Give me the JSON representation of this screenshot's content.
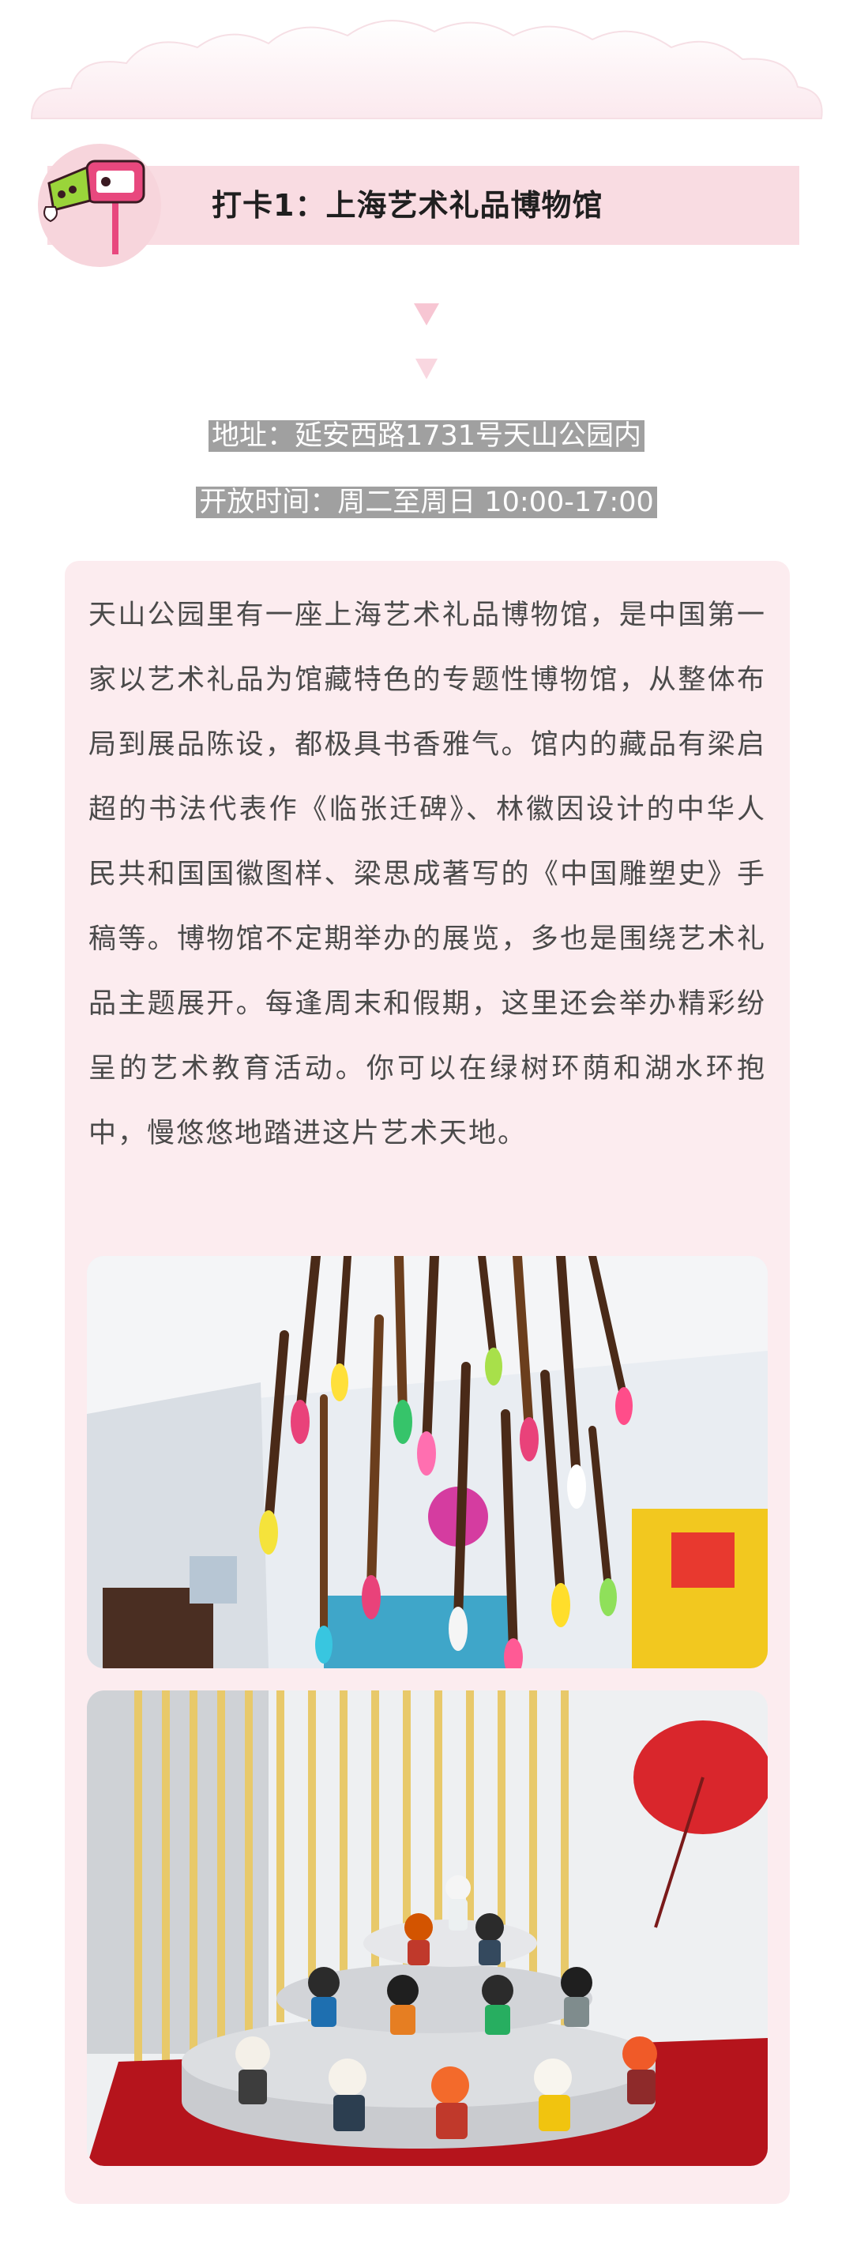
{
  "header": {
    "title": "打卡1：上海艺术礼品博物馆"
  },
  "info": {
    "address": "地址：延安西路1731号天山公园内",
    "hours": "开放时间：周二至周日 10:00-17:00"
  },
  "body": {
    "paragraph": "天山公园里有一座上海艺术礼品博物馆，是中国第一家以艺术礼品为馆藏特色的专题性博物馆，从整体布局到展品陈设，都极具书香雅气。馆内的藏品有梁启超的书法代表作《临张迁碑》、林徽因设计的中华人民共和国国徽图样、梁思成著写的《中国雕塑史》手稿等。博物馆不定期举办的展览，多也是围绕艺术礼品主题展开。每逢周末和假期，这里还会举办精彩纷呈的艺术教育活动。你可以在绿树环荫和湖水环抱中，慢悠悠地踏进这片艺术天地。"
  },
  "colors": {
    "accent_pink": "#e8487e",
    "title_bar": "#f9dce2",
    "card_bg": "#fcecef",
    "info_bg": "#a0a0a0"
  },
  "icons": {
    "badge": "camera-icon"
  }
}
